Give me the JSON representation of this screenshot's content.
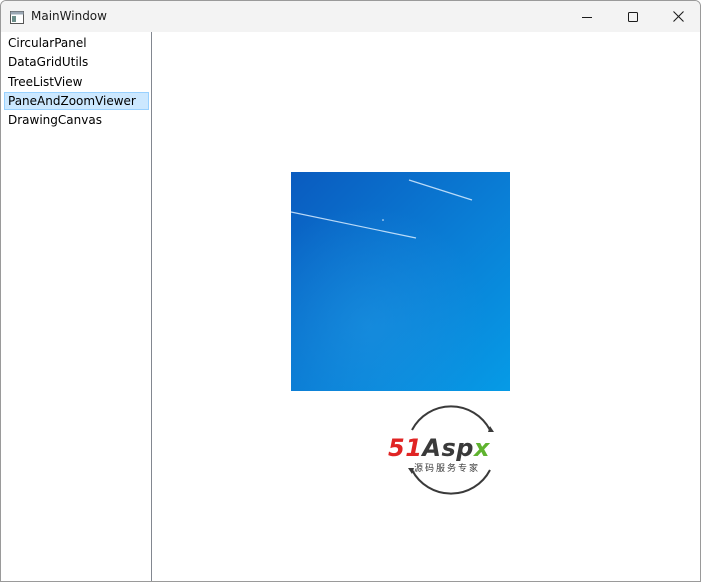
{
  "window": {
    "title": "MainWindow",
    "icon": "window-app-icon",
    "buttons": {
      "minimize_icon": "minimize-icon",
      "maximize_icon": "maximize-icon",
      "close_icon": "close-icon"
    }
  },
  "sidebar": {
    "items": [
      {
        "label": "CircularPanel",
        "selected": false
      },
      {
        "label": "DataGridUtils",
        "selected": false
      },
      {
        "label": "TreeListView",
        "selected": false
      },
      {
        "label": "PaneAndZoomViewer",
        "selected": true
      },
      {
        "label": "DrawingCanvas",
        "selected": false
      }
    ]
  },
  "content": {
    "image": "blue-sky-photo",
    "logo": {
      "part1": "51",
      "part2": "Asp",
      "part3": "x",
      "subtitle": "源码服务专家"
    }
  },
  "colors": {
    "selection_bg": "#cce8ff",
    "selection_border": "#99d1ff",
    "sky_top": "#0a5fc4",
    "sky_bottom": "#0795e0",
    "logo_red": "#e02424",
    "logo_green": "#5fb32f"
  }
}
